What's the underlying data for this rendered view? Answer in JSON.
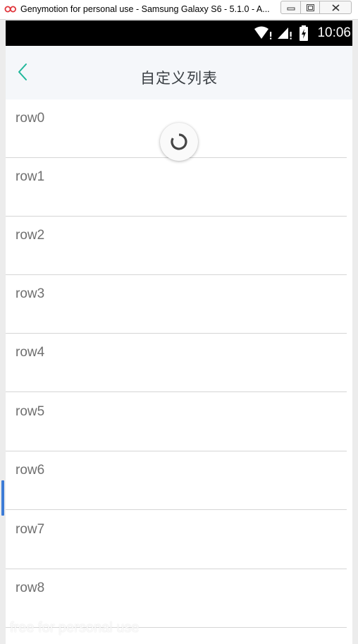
{
  "window": {
    "title": "Genymotion for personal use - Samsung Galaxy S6 - 5.1.0 - A..."
  },
  "status_bar": {
    "time": "10:06",
    "icons": [
      "wifi-icon",
      "signal-icon",
      "battery-icon"
    ]
  },
  "header": {
    "title": "自定义列表",
    "back_icon": "chevron-left-icon"
  },
  "list": {
    "rows": [
      {
        "label": "row0"
      },
      {
        "label": "row1"
      },
      {
        "label": "row2"
      },
      {
        "label": "row3"
      },
      {
        "label": "row4"
      },
      {
        "label": "row5"
      },
      {
        "label": "row6"
      },
      {
        "label": "row7"
      },
      {
        "label": "row8"
      }
    ]
  },
  "loading_indicator": "refresh-spinner-icon",
  "watermark": "free for personal use",
  "colors": {
    "accent": "#1fb79a",
    "header_bg": "#f5f7fa",
    "title_text": "#3a3f44",
    "row_text": "#6f6f6f",
    "divider": "#d5d5d5"
  }
}
